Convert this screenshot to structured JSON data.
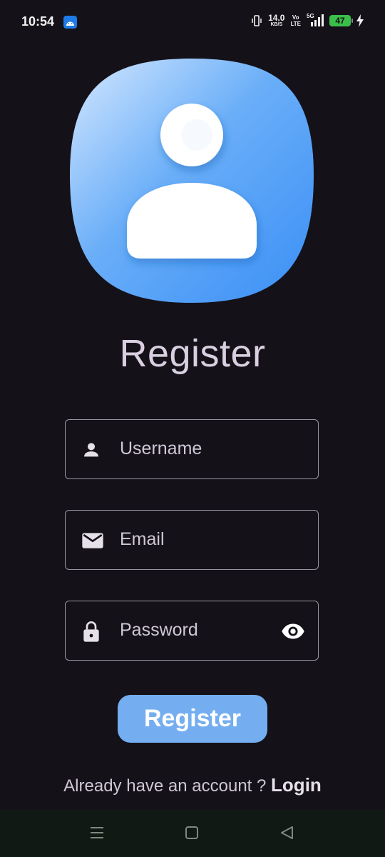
{
  "status_bar": {
    "time": "10:54",
    "net_speed": "14.0",
    "net_unit": "KB/S",
    "volte_top": "Vo",
    "volte_bottom": "LTE",
    "network": "5G",
    "battery": "47"
  },
  "page": {
    "title": "Register"
  },
  "form": {
    "username_placeholder": "Username",
    "email_placeholder": "Email",
    "password_placeholder": "Password",
    "submit_label": "Register"
  },
  "footer": {
    "prompt": "Already have an account ?",
    "login_label": "Login"
  },
  "icons": {
    "username": "person-icon",
    "email": "mail-icon",
    "password": "lock-icon",
    "visibility": "eye-icon"
  },
  "colors": {
    "background": "#141218",
    "accent": "#74aef0",
    "logo_blue": "#3f95f7",
    "field_border": "#9a96a0"
  }
}
